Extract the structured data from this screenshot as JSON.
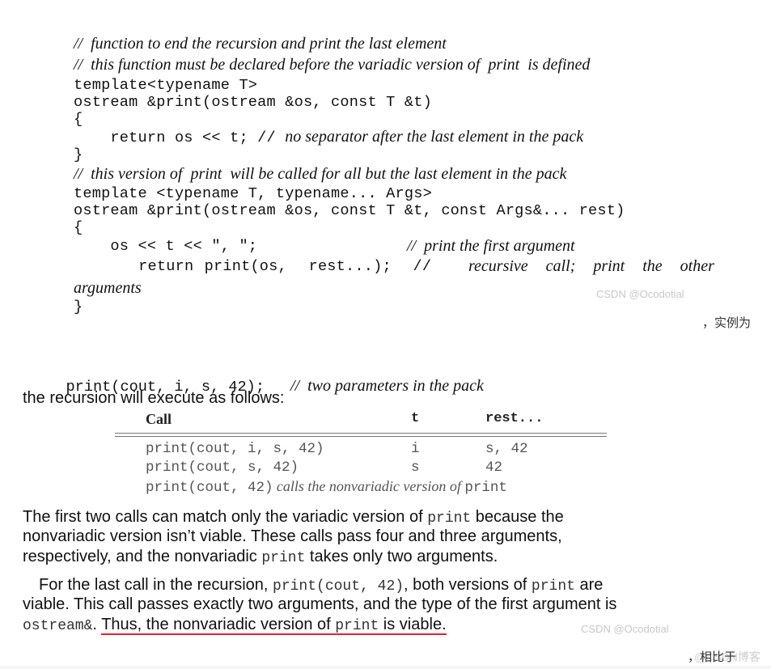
{
  "code_block": {
    "lines": [
      {
        "comment": "//  function to end the recursion and print the last element"
      },
      {
        "comment": "//  this function must be declared before the variadic version of  print  is defined"
      },
      {
        "code": "template<typename T>"
      },
      {
        "code": "ostream &print(ostream &os, const T &t)"
      },
      {
        "code": "{"
      },
      {
        "code": "    return os << t; // ",
        "comment": "no separator after the last element in the pack"
      },
      {
        "code": "}"
      },
      {
        "comment": "//  this version of  print  will be called for all but the last element in the pack"
      },
      {
        "code": "template <typename T, typename... Args>"
      },
      {
        "code": "ostream &print(ostream &os, const T &t, const Args&... rest)"
      },
      {
        "code": "{"
      },
      {
        "code": "    os << t << \", \";",
        "comment": "//  print the first argument"
      },
      {
        "code": "      return print(os,  rest...);  //",
        "comment": "recursive  call;  print  the  other"
      },
      {
        "comment": "arguments"
      },
      {
        "code": "}"
      }
    ]
  },
  "watermarks": {
    "csdn_1": "CSDN @Ocodotial",
    "csdn_2": "CSDN @Ocodotial",
    "csdn_3": "@CSDN博客"
  },
  "inline_cn_1": "，实例为",
  "inline_cn_2": "，相比于",
  "example_call": {
    "code": "print(cout, i, s, 42);",
    "comment": "//  two parameters in the pack"
  },
  "intro_text": "the recursion will execute as follows:",
  "table": {
    "headers": [
      "Call",
      "t",
      "rest..."
    ],
    "rows": [
      {
        "call": "print(cout, i, s, 42)",
        "t": "i",
        "rest": "s, 42"
      },
      {
        "call": "print(cout, s, 42)",
        "t": "s",
        "rest": "42"
      },
      {
        "call": "print(cout, 42)",
        "note_prefix": "calls the nonvariadic version of ",
        "note_code": "print"
      }
    ]
  },
  "paragraph_1": {
    "l1a": "The first two calls can match only the variadic version of ",
    "l1code": "print",
    "l1b": " because the",
    "l2": "nonvariadic version isn’t viable. These calls pass four and three arguments,",
    "l3a": "respectively, and the nonvariadic ",
    "l3code": "print",
    "l3b": " takes only two arguments."
  },
  "paragraph_2": {
    "l1a": "For the last call in the recursion, ",
    "l1code": "print(cout,  42)",
    "l1b": ", both versions of ",
    "l1code2": "print",
    "l1c": " are",
    "l2": "viable. This call passes exactly two arguments, and the type of the first argument is",
    "l3code": "ostream&",
    "l3a": ". ",
    "l3u1": "Thus, the nonvariadic version of ",
    "l3ucode": "print",
    "l3u2": " is viable."
  },
  "colors": {
    "underline": "#e8202a",
    "watermark": "#c8c8c8"
  }
}
